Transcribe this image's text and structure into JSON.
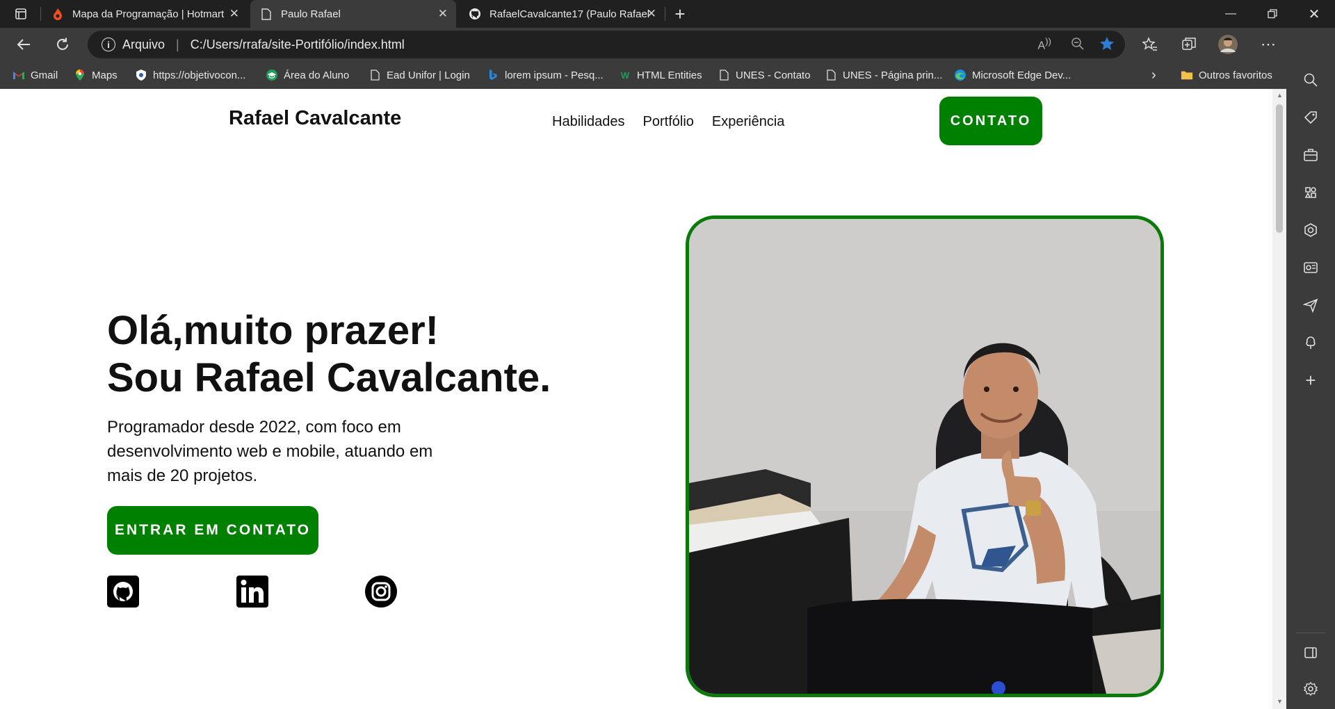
{
  "browser": {
    "tabs": [
      {
        "title": "Mapa da Programação | Hotmart",
        "icon": "hotmart-icon",
        "active": false
      },
      {
        "title": "Paulo Rafael",
        "icon": "page-icon",
        "active": true
      },
      {
        "title": "RafaelCavalcante17 (Paulo Rafael",
        "icon": "github-icon",
        "active": false
      }
    ],
    "address": {
      "scheme_label": "Arquivo",
      "url": "C:/Users/rrafa/site-Portifólio/index.html"
    },
    "bookmarks": [
      {
        "label": "Gmail",
        "icon": "gmail-icon"
      },
      {
        "label": "Maps",
        "icon": "maps-icon"
      },
      {
        "label": "https://objetivocon...",
        "icon": "shield-icon"
      },
      {
        "label": "Área do Aluno",
        "icon": "graduation-icon"
      },
      {
        "label": "Ead Unifor | Login",
        "icon": "page-icon"
      },
      {
        "label": "lorem ipsum - Pesq...",
        "icon": "bing-icon"
      },
      {
        "label": "HTML Entities",
        "icon": "w-icon"
      },
      {
        "label": "UNES - Contato",
        "icon": "page-icon"
      },
      {
        "label": "UNES - Página prin...",
        "icon": "page-icon"
      },
      {
        "label": "Microsoft Edge Dev...",
        "icon": "edge-icon"
      }
    ],
    "other_favorites": "Outros favoritos",
    "accent_color": "#2d7dd2"
  },
  "site": {
    "logo": "Rafael Cavalcante",
    "nav": [
      "Habilidades",
      "Portfólio",
      "Experiência"
    ],
    "contact_button": "CONTATO",
    "hero": {
      "line1": "Olá,muito prazer!",
      "line2": "Sou Rafael Cavalcante.",
      "description": "Programador desde 2022, com foco em desenvolvimento web e mobile, atuando em mais de 20 projetos.",
      "cta": "ENTRAR EM CONTATO"
    },
    "social": [
      "github-icon",
      "linkedin-icon",
      "instagram-icon"
    ],
    "brand_color": "#008000",
    "photo_border_color": "#0a7a0a"
  }
}
